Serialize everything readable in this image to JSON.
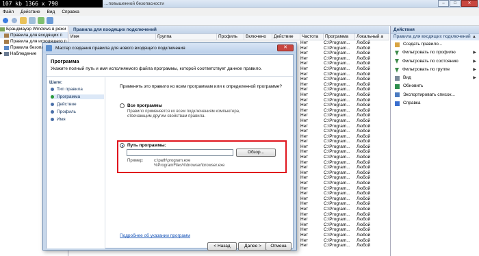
{
  "titlebar": {
    "badge": "107 kb 1366 x 790",
    "title": "…повышенной безопасности"
  },
  "menu": [
    "Файл",
    "Действие",
    "Вид",
    "Справка"
  ],
  "tree": {
    "root": "Брандмауэр Windows в режи",
    "inbound": "Правила для входящих п",
    "outbound": "Правила для исходящего п",
    "security": "Правила безопасности п",
    "monitoring": "Наблюдение"
  },
  "center": {
    "header": "Правила для входящих подключений",
    "columns": [
      "Имя",
      "Группа",
      "Профиль",
      "Включено",
      "Действие",
      "Частота",
      "Программа",
      "Локальный а"
    ],
    "rows": [
      [
        "Нет",
        "C:\\Program...",
        "Любой"
      ],
      [
        "Нет",
        "C:\\Program...",
        "Любой"
      ],
      [
        "Нет",
        "C:\\Program...",
        "Любой"
      ],
      [
        "Нет",
        "C:\\Program...",
        "Любой"
      ],
      [
        "Нет",
        "C:\\Program...",
        "Любой"
      ],
      [
        "Нет",
        "C:\\Program...",
        "Любой"
      ],
      [
        "Нет",
        "C:\\Program...",
        "Любой"
      ],
      [
        "Нет",
        "C:\\Program...",
        "Любой"
      ],
      [
        "Нет",
        "C:\\Program...",
        "Любой"
      ],
      [
        "Нет",
        "C:\\Program...",
        "Любой"
      ],
      [
        "Нет",
        "C:\\Program...",
        "Любой"
      ],
      [
        "Нет",
        "C:\\Program...",
        "Любой"
      ],
      [
        "Нет",
        "C:\\Program...",
        "Любой"
      ],
      [
        "Нет",
        "C:\\Program...",
        "Любой"
      ],
      [
        "Нет",
        "C:\\Program...",
        "Любой"
      ],
      [
        "Нет",
        "C:\\Program...",
        "Любой"
      ],
      [
        "Нет",
        "C:\\Program...",
        "Любой"
      ],
      [
        "Нет",
        "C:\\Program...",
        "Любой"
      ],
      [
        "Нет",
        "C:\\Program...",
        "Любой"
      ],
      [
        "Нет",
        "C:\\Program...",
        "Любой"
      ],
      [
        "Нет",
        "C:\\Program...",
        "Любой"
      ],
      [
        "Нет",
        "C:\\Program...",
        "Любой"
      ],
      [
        "Нет",
        "C:\\Program...",
        "Любой"
      ],
      [
        "Нет",
        "C:\\Program...",
        "Любой"
      ],
      [
        "Нет",
        "C:\\Program...",
        "Любой"
      ],
      [
        "Нет",
        "C:\\Program...",
        "Любой"
      ],
      [
        "Нет",
        "C:\\Program...",
        "Любой"
      ],
      [
        "Нет",
        "C:\\Program...",
        "Любой"
      ],
      [
        "Нет",
        "C:\\Program...",
        "Любой"
      ],
      [
        "Нет",
        "C:\\Program...",
        "Любой"
      ],
      [
        "Нет",
        "C:\\Program...",
        "Любой"
      ],
      [
        "Нет",
        "C:\\Program...",
        "Любой"
      ],
      [
        "Нет",
        "C:\\Program...",
        "Любой"
      ],
      [
        "Нет",
        "C:\\Program...",
        "Любой"
      ],
      [
        "Нет",
        "C:\\Program...",
        "Любой"
      ],
      [
        "Нет",
        "C:\\Program...",
        "Любой"
      ],
      [
        "Нет",
        "C:\\Program...",
        "Любой"
      ],
      [
        "Нет",
        "C:\\Program...",
        "Любой"
      ],
      [
        "Нет",
        "C:\\Program...",
        "Любой"
      ],
      [
        "Нет",
        "C:\\Program...",
        "Любой"
      ]
    ]
  },
  "actions": {
    "header": "Действия",
    "sub": "Правила для входящих подключений",
    "items": [
      {
        "label": "Создать правило...",
        "icon": "new-rule-icon",
        "arrow": false
      },
      {
        "label": "Фильтровать по профилю",
        "icon": "filter-icon",
        "arrow": true
      },
      {
        "label": "Фильтровать по состоянию",
        "icon": "filter-icon",
        "arrow": true
      },
      {
        "label": "Фильтровать по группе",
        "icon": "filter-icon",
        "arrow": true
      },
      {
        "label": "Вид",
        "icon": "view-icon",
        "arrow": true
      },
      {
        "label": "Обновить",
        "icon": "refresh-icon",
        "arrow": false
      },
      {
        "label": "Экспортировать список...",
        "icon": "export-icon",
        "arrow": false
      },
      {
        "label": "Справка",
        "icon": "help-icon",
        "arrow": false
      }
    ]
  },
  "wizard": {
    "title": "Мастер создания правила для нового входящего подключения",
    "heading": "Программа",
    "description": "Укажите полный путь и имя исполняемого файла программы, которой соответствует данное правило.",
    "steps_title": "Шаги:",
    "steps": [
      "Тип правила",
      "Программа",
      "Действие",
      "Профиль",
      "Имя"
    ],
    "question": "Применять это правило ко всем программам или к определенной программе?",
    "all_label": "Все программы",
    "all_desc": "Правило применяется ко всем подключениям компьютера, отвечающим другим свойствам правила.",
    "path_label": "Путь программы:",
    "path_value": "",
    "browse": "Обзор...",
    "example_label": "Пример:",
    "example_1": "c:\\path\\program.exe",
    "example_2": "%ProgramFiles%\\browser\\browser.exe",
    "link": "Подробнее об указании программ",
    "back": "< Назад",
    "next": "Далее >",
    "cancel": "Отмена"
  },
  "colors": {
    "accent": "#1a56b8",
    "highlight": "#e0141d",
    "header": "#c5d5ea"
  }
}
